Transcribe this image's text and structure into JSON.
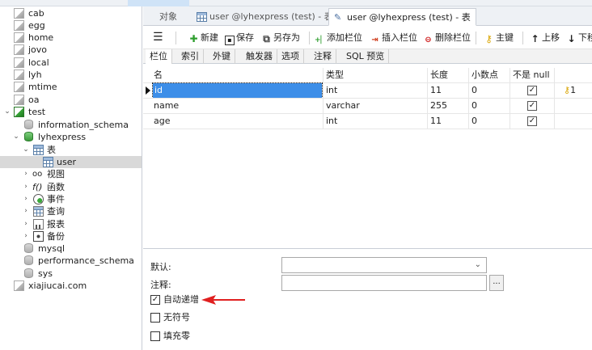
{
  "sidebar": {
    "items": [
      {
        "label": "cab",
        "kind": "db"
      },
      {
        "label": "egg",
        "kind": "db"
      },
      {
        "label": "home",
        "kind": "db"
      },
      {
        "label": "jovo",
        "kind": "db"
      },
      {
        "label": "local",
        "kind": "db"
      },
      {
        "label": "lyh",
        "kind": "db"
      },
      {
        "label": "mtime",
        "kind": "db"
      },
      {
        "label": "oa",
        "kind": "db"
      },
      {
        "label": "test",
        "kind": "db-open"
      },
      {
        "label": "information_schema",
        "kind": "schema"
      },
      {
        "label": "lyhexpress",
        "kind": "schema-open"
      },
      {
        "label": "表",
        "kind": "tables"
      },
      {
        "label": "user",
        "kind": "table"
      },
      {
        "label": "视图",
        "kind": "views"
      },
      {
        "label": "函数",
        "kind": "functions"
      },
      {
        "label": "事件",
        "kind": "events"
      },
      {
        "label": "查询",
        "kind": "queries"
      },
      {
        "label": "报表",
        "kind": "reports"
      },
      {
        "label": "备份",
        "kind": "backups"
      },
      {
        "label": "mysql",
        "kind": "schema"
      },
      {
        "label": "performance_schema",
        "kind": "schema"
      },
      {
        "label": "sys",
        "kind": "schema"
      },
      {
        "label": "xiajiucai.com",
        "kind": "db"
      }
    ]
  },
  "tabs": [
    {
      "label": "对象"
    },
    {
      "label": "user @lyhexpress (test) - 表"
    },
    {
      "label": "user @lyhexpress (test) - 表"
    }
  ],
  "toolbar": {
    "menu_icon": "menu-icon",
    "new_label": "新建",
    "save_label": "保存",
    "save_as_label": "另存为",
    "add_field_label": "添加栏位",
    "insert_field_label": "插入栏位",
    "delete_field_label": "删除栏位",
    "primary_key_label": "主键",
    "move_up_label": "上移",
    "move_down_label": "下移"
  },
  "subtabs": [
    "栏位",
    "索引",
    "外键",
    "触发器",
    "选项",
    "注释",
    "SQL 预览"
  ],
  "grid": {
    "headers": [
      "名",
      "类型",
      "长度",
      "小数点",
      "不是 null"
    ],
    "rows": [
      {
        "name": "id",
        "type": "int",
        "length": "11",
        "decimals": "0",
        "not_null": true,
        "key": "1"
      },
      {
        "name": "name",
        "type": "varchar",
        "length": "255",
        "decimals": "0",
        "not_null": true,
        "key": ""
      },
      {
        "name": "age",
        "type": "int",
        "length": "11",
        "decimals": "0",
        "not_null": true,
        "key": ""
      }
    ]
  },
  "props": {
    "default_label": "默认:",
    "default_value": "",
    "comment_label": "注释:",
    "comment_value": "",
    "dots_label": "...",
    "auto_increment_label": "自动递增",
    "auto_increment_checked": true,
    "unsigned_label": "无符号",
    "unsigned_checked": false,
    "zerofill_label": "填充零",
    "zerofill_checked": false
  },
  "colors": {
    "selection": "#3d8ee8",
    "annotation_arrow": "#e02020",
    "key_icon": "#d9a400"
  }
}
